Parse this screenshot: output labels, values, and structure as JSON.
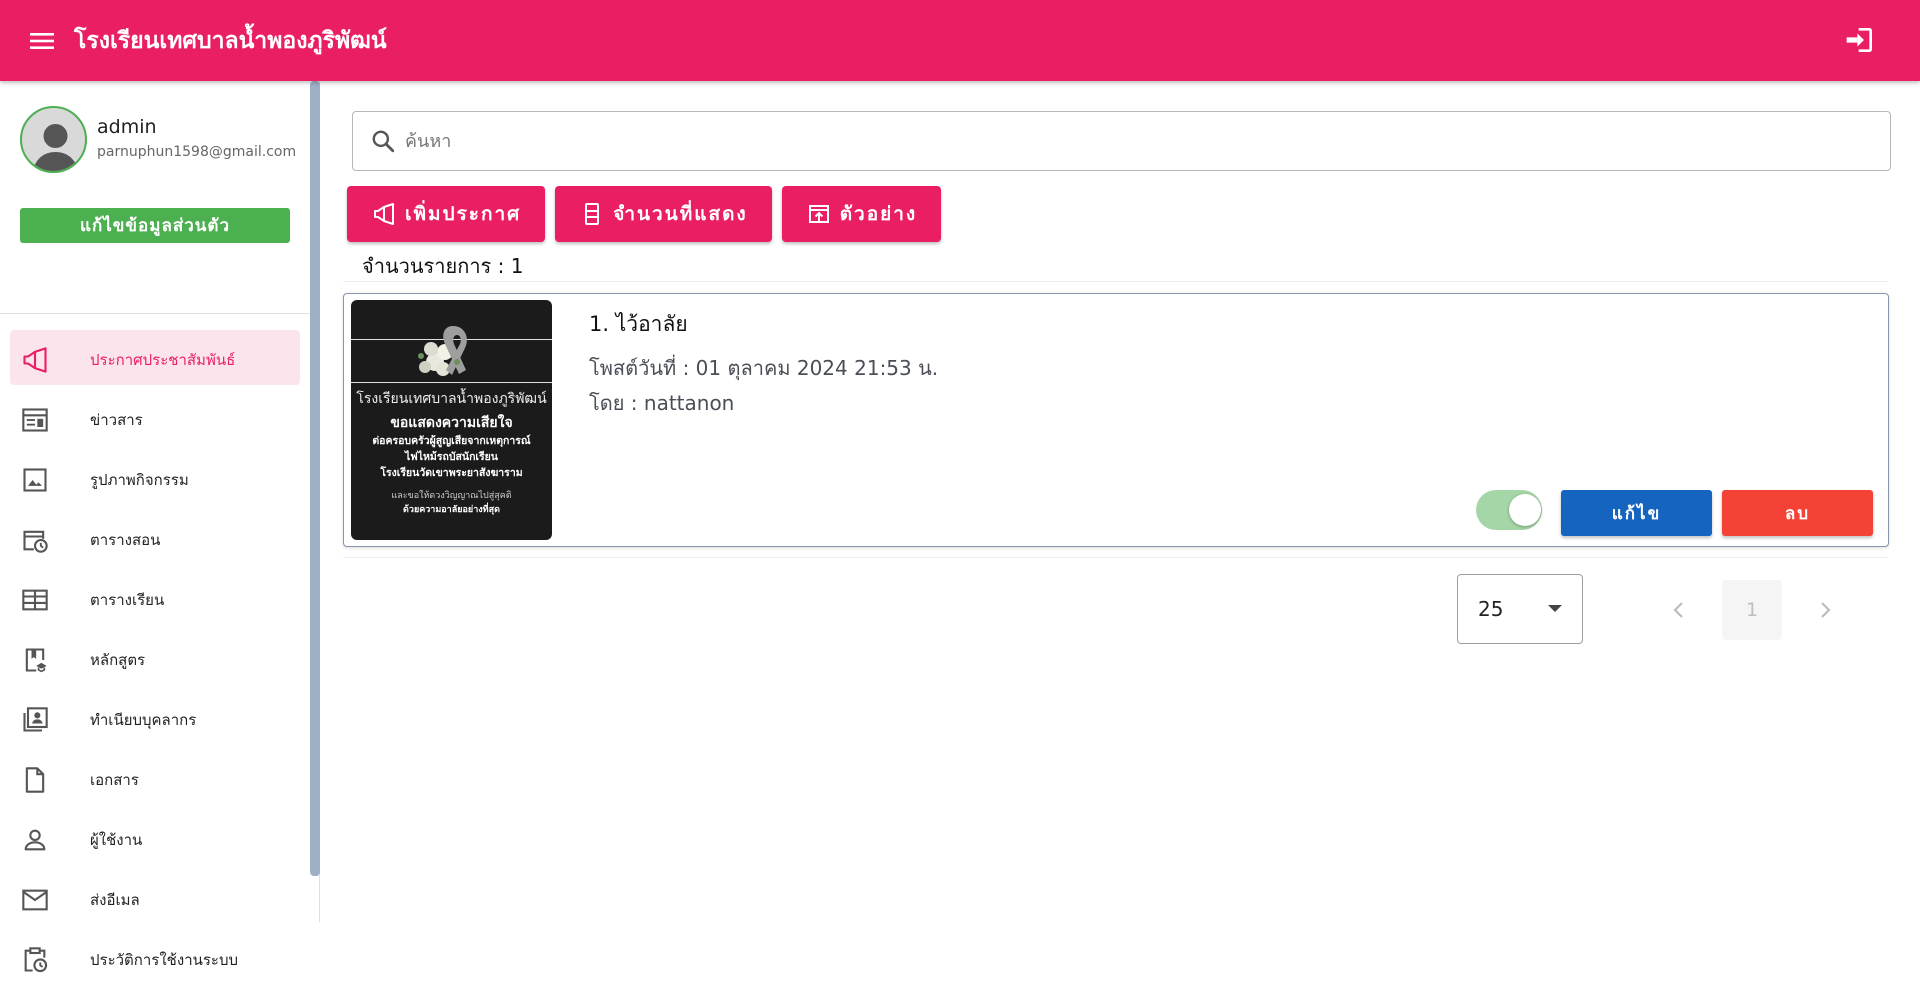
{
  "appbar": {
    "title": "โรงเรียนเทศบาลน้ำพองภูริพัฒน์",
    "menu_icon": "menu-icon",
    "login_icon": "login-icon",
    "bg_color": "#e91e63"
  },
  "profile": {
    "name": "admin",
    "email": "parnuphun1598@gmail.com",
    "edit_label": "แก้ไขข้อมูลส่วนตัว"
  },
  "sidebar": {
    "items": [
      {
        "label": "ประกาศประชาสัมพันธ์",
        "icon": "megaphone-icon",
        "active": true
      },
      {
        "label": "ข่าวสาร",
        "icon": "newspaper-icon"
      },
      {
        "label": "รูปภาพกิจกรรม",
        "icon": "image-icon"
      },
      {
        "label": "ตารางสอน",
        "icon": "calendar-clock-icon"
      },
      {
        "label": "ตารางเรียน",
        "icon": "table-icon"
      },
      {
        "label": "หลักสูตร",
        "icon": "book-school-icon"
      },
      {
        "label": "ทำเนียบบุคลากร",
        "icon": "contacts-icon"
      },
      {
        "label": "เอกสาร",
        "icon": "file-icon"
      },
      {
        "label": "ผู้ใช้งาน",
        "icon": "user-icon"
      },
      {
        "label": "ส่งอีเมล",
        "icon": "mail-icon"
      },
      {
        "label": "ประวัติการใช้งานระบบ",
        "icon": "clipboard-clock-icon"
      }
    ]
  },
  "search": {
    "placeholder": "ค้นหา",
    "value": ""
  },
  "toolbar": {
    "add_label": "เพิ่มประกาศ",
    "display_count_label": "จำนวนที่แสดง",
    "preview_label": "ตัวอย่าง"
  },
  "list": {
    "count_label": "จำนวนรายการ : 1",
    "items": [
      {
        "title": "1. ไว้อาลัย",
        "date": "โพสต์วันที่ : 01 ตุลาคม 2024 21:53 น.",
        "author": "โดย : nattanon",
        "published": true,
        "edit_label": "แก้ไข",
        "delete_label": "ลบ",
        "thumb": {
          "line1": "โรงเรียนเทศบาลน้ำพองภูริพัฒน์",
          "line2": "ขอแสดงความเสียใจ",
          "line3": "ต่อครอบครัวผู้สูญเสียจากเหตุการณ์",
          "line4": "ไฟไหม้รถบัสนักเรียน",
          "line5": "โรงเรียนวัดเขาพระยาสังฆาราม",
          "line6": "และขอให้ดวงวิญญาณไปสู่สุคติ",
          "line7": "ด้วยความอาลัยอย่างที่สุด"
        }
      }
    ]
  },
  "pagination": {
    "per_page": "25",
    "current_page": "1"
  },
  "colors": {
    "primary": "#e91e63",
    "success": "#4caf50",
    "edit": "#1565c0",
    "delete": "#f44336"
  }
}
